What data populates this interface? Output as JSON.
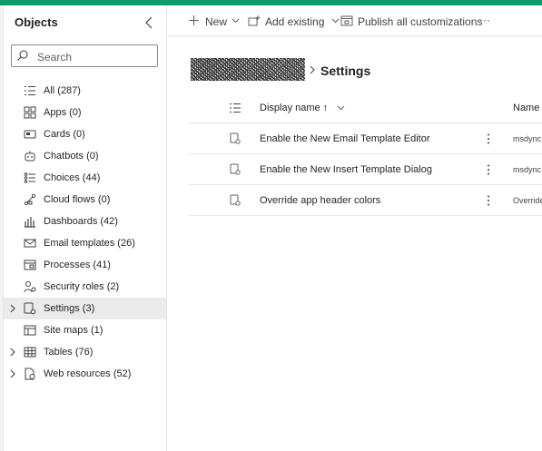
{
  "colors": {
    "brand": "#0f9b6e",
    "selected_bg": "#ebebeb",
    "text": "#242424"
  },
  "sidebar": {
    "title": "Objects",
    "search_placeholder": "Search",
    "items": [
      {
        "label": "All  (287)",
        "icon": "list-icon",
        "expandable": false,
        "selected": false
      },
      {
        "label": "Apps  (0)",
        "icon": "apps-grid-icon",
        "expandable": false,
        "selected": false
      },
      {
        "label": "Cards  (0)",
        "icon": "card-icon",
        "expandable": false,
        "selected": false
      },
      {
        "label": "Chatbots  (0)",
        "icon": "bot-icon",
        "expandable": false,
        "selected": false
      },
      {
        "label": "Choices  (44)",
        "icon": "choice-list-icon",
        "expandable": false,
        "selected": false
      },
      {
        "label": "Cloud flows  (0)",
        "icon": "flow-icon",
        "expandable": false,
        "selected": false
      },
      {
        "label": "Dashboards  (42)",
        "icon": "dashboard-icon",
        "expandable": false,
        "selected": false
      },
      {
        "label": "Email templates  (26)",
        "icon": "email-icon",
        "expandable": false,
        "selected": false
      },
      {
        "label": "Processes  (41)",
        "icon": "process-icon",
        "expandable": false,
        "selected": false
      },
      {
        "label": "Security roles  (2)",
        "icon": "security-role-icon",
        "expandable": false,
        "selected": false
      },
      {
        "label": "Settings  (3)",
        "icon": "settings-icon",
        "expandable": true,
        "selected": true
      },
      {
        "label": "Site maps  (1)",
        "icon": "sitemap-icon",
        "expandable": false,
        "selected": false
      },
      {
        "label": "Tables  (76)",
        "icon": "table-icon",
        "expandable": true,
        "selected": false
      },
      {
        "label": "Web resources  (52)",
        "icon": "web-resource-icon",
        "expandable": true,
        "selected": false
      }
    ]
  },
  "commandbar": {
    "new_label": "New",
    "add_existing_label": "Add existing",
    "publish_label": "Publish all customizations",
    "more_label": "···"
  },
  "breadcrumb": {
    "current": "Settings"
  },
  "grid": {
    "columns": {
      "display_name": "Display name ↑",
      "name": "Name"
    },
    "rows": [
      {
        "display_name": "Enable the New Email Template Editor",
        "name": "msdync"
      },
      {
        "display_name": "Enable the New Insert Template Dialog",
        "name": "msdync"
      },
      {
        "display_name": "Override app header colors",
        "name": "Override"
      }
    ]
  }
}
